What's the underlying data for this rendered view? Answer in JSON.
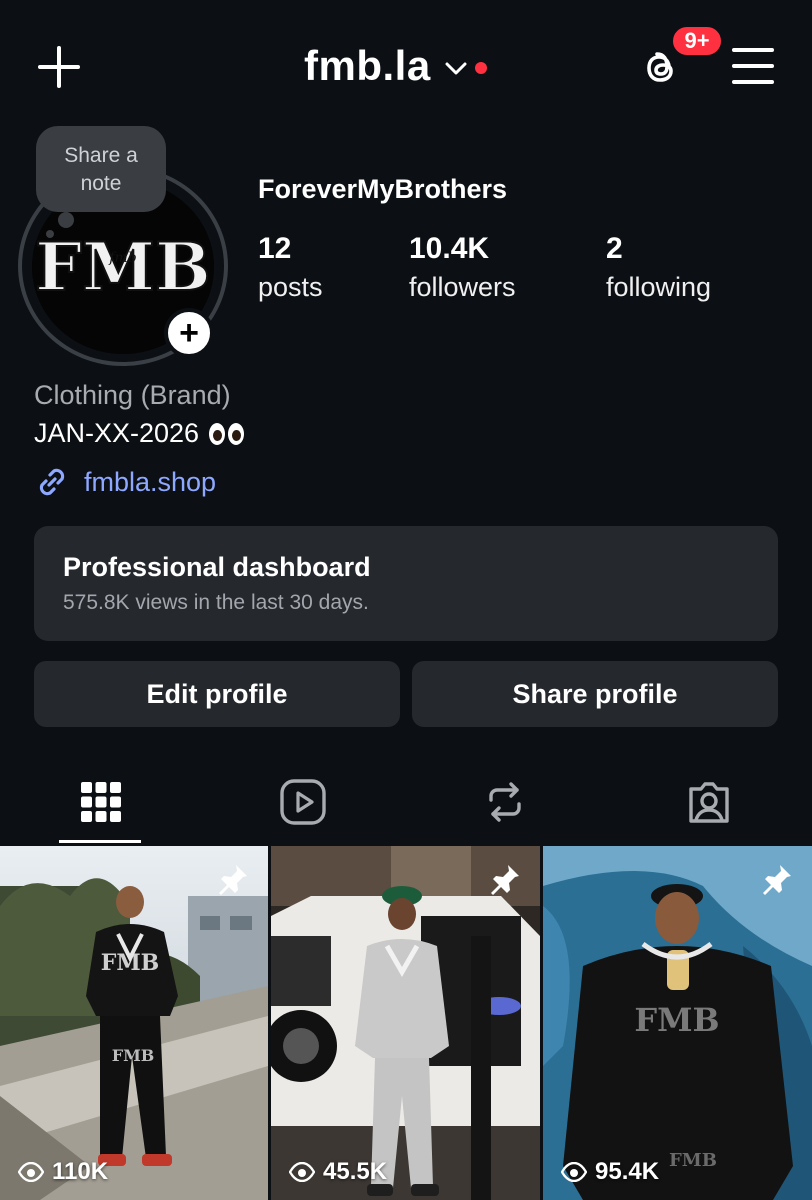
{
  "header": {
    "username": "fmb.la",
    "notification_badge": "9+"
  },
  "profile": {
    "note_text": "Share a note",
    "avatar_logo_text": "FMB",
    "avatar_logo_small": "fmb",
    "display_name": "ForeverMyBrothers",
    "stats": [
      {
        "value": "12",
        "label": "posts"
      },
      {
        "value": "10.4K",
        "label": "followers"
      },
      {
        "value": "2",
        "label": "following"
      }
    ],
    "category": "Clothing (Brand)",
    "bio": "JAN-XX-2026",
    "bio_emoji": "eyes-emoji",
    "link": "fmbla.shop"
  },
  "dashboard": {
    "title": "Professional dashboard",
    "subtitle": "575.8K views in the last 30 days."
  },
  "actions": {
    "edit": "Edit profile",
    "share": "Share profile"
  },
  "tabs": [
    {
      "icon": "grid-icon",
      "active": true
    },
    {
      "icon": "reels-icon",
      "active": false
    },
    {
      "icon": "reposts-icon",
      "active": false
    },
    {
      "icon": "tagged-icon",
      "active": false
    }
  ],
  "posts": [
    {
      "views": "110K",
      "pinned": true,
      "sweatshirt_text": "FMB",
      "pants_text": "FMB"
    },
    {
      "views": "45.5K",
      "pinned": true
    },
    {
      "views": "95.4K",
      "pinned": true,
      "sweatshirt_text": "FMB",
      "pants_text": "FMB"
    }
  ],
  "colors": {
    "background": "#0c1014",
    "card": "#25292e",
    "link": "#8fa8ff",
    "badge": "#ff3040"
  }
}
